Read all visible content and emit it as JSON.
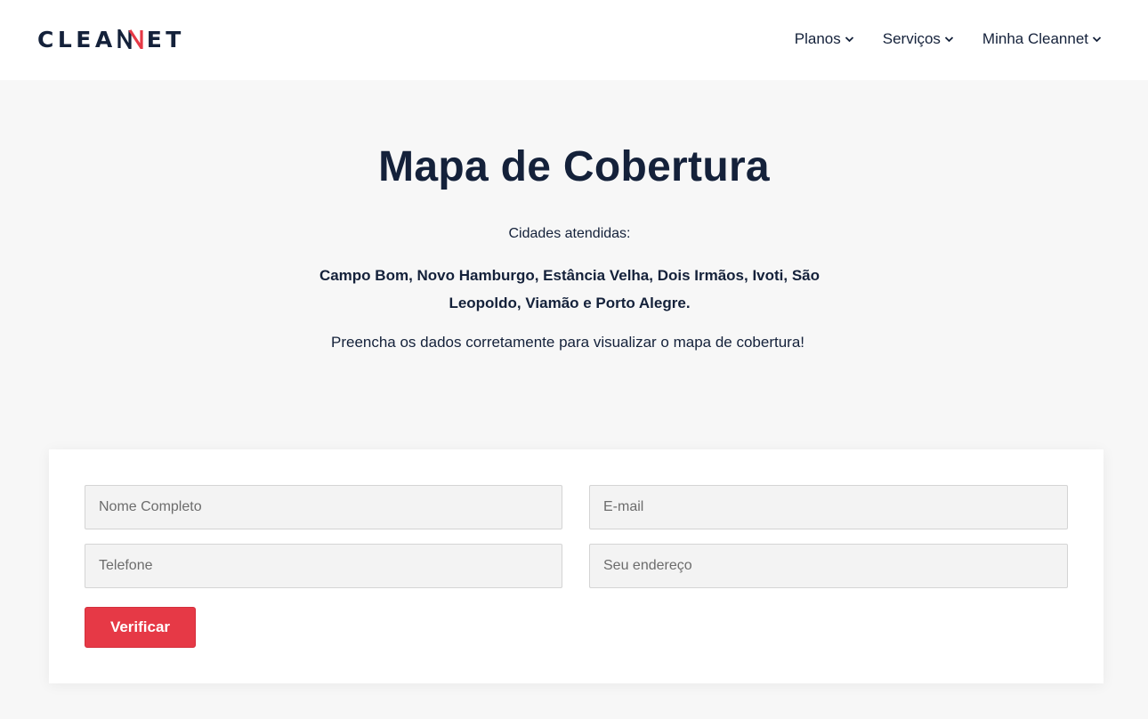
{
  "header": {
    "logo": {
      "left": "CLEA",
      "mark": "N",
      "right": "ET",
      "mark_color": "#e63946"
    },
    "nav": [
      {
        "label": "Planos",
        "icon": "chevron-down-icon"
      },
      {
        "label": "Serviços",
        "icon": "chevron-down-icon"
      },
      {
        "label": "Minha Cleannet",
        "icon": "chevron-down-icon"
      }
    ]
  },
  "main": {
    "title": "Mapa de Cobertura",
    "subtitle": "Cidades atendidas:",
    "cities": "Campo Bom, Novo Hamburgo, Estância Velha, Dois Irmãos, Ivoti, São Leopoldo, Viamão e Porto Alegre.",
    "note": "Preencha os dados corretamente para visualizar o mapa de cobertura!"
  },
  "form": {
    "nome_placeholder": "Nome Completo",
    "email_placeholder": "E-mail",
    "telefone_placeholder": "Telefone",
    "endereco_placeholder": "Seu endereço",
    "submit_label": "Verificar"
  },
  "colors": {
    "accent": "#e63946",
    "text_dark": "#14213a",
    "background": "#f7f7f7"
  }
}
